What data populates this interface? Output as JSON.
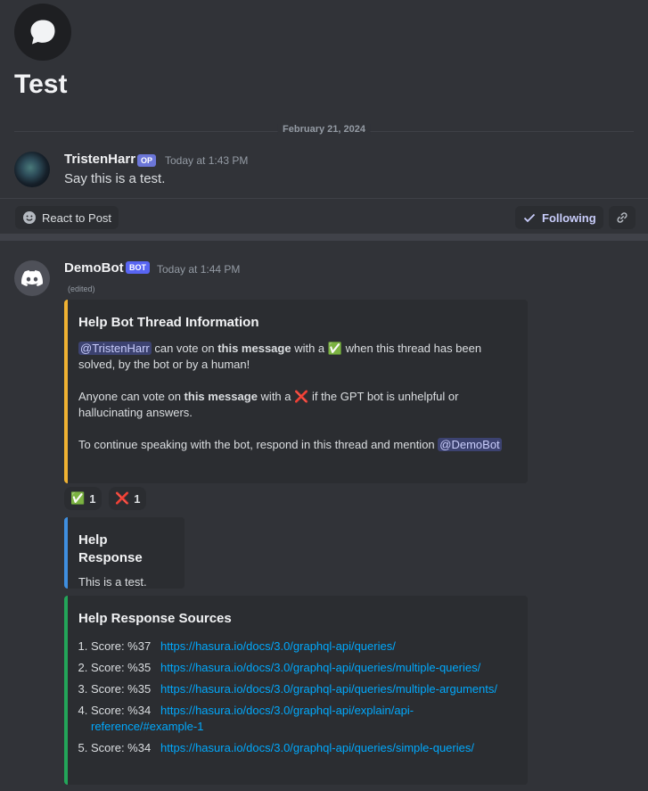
{
  "post": {
    "title": "Test",
    "date_divider": "February 21, 2024"
  },
  "op_message": {
    "author": "TristenHarr",
    "tag": "OP",
    "time": "Today at 1:43 PM",
    "text": "Say this is a test."
  },
  "actions": {
    "react_label": "React to Post",
    "following_label": "Following"
  },
  "bot_message": {
    "author": "DemoBot",
    "tag": "BOT",
    "time": "Today at 1:44 PM",
    "edited": "(edited)"
  },
  "embed_info": {
    "title": "Help Bot Thread Information",
    "p1_mention": "@TristenHarr",
    "p1_a": "can vote on",
    "p1_bold": "this message",
    "p1_b": "with a",
    "p1_c": "when this thread has been solved, by the bot or by a human!",
    "p2_a": "Anyone can vote on",
    "p2_bold": "this message",
    "p2_b": "with a",
    "p2_c": "if the GPT bot is unhelpful or hallucinating answers.",
    "p3_a": "To continue speaking with the bot, respond in this thread and mention",
    "p3_mention": "@DemoBot"
  },
  "reactions": [
    {
      "emoji": "✅",
      "count": "1"
    },
    {
      "emoji": "❌",
      "count": "1"
    }
  ],
  "embed_response": {
    "title": "Help Response",
    "text": "This is a test."
  },
  "embed_sources": {
    "title": "Help Response Sources",
    "items": [
      {
        "score": "Score: %37",
        "url": "https://hasura.io/docs/3.0/graphql-api/queries/"
      },
      {
        "score": "Score: %35",
        "url": "https://hasura.io/docs/3.0/graphql-api/queries/multiple-queries/"
      },
      {
        "score": "Score: %35",
        "url": "https://hasura.io/docs/3.0/graphql-api/queries/multiple-arguments/"
      },
      {
        "score": "Score: %34",
        "url": "https://hasura.io/docs/3.0/graphql-api/explain/api-reference/#example-1"
      },
      {
        "score": "Score: %34",
        "url": "https://hasura.io/docs/3.0/graphql-api/queries/simple-queries/"
      }
    ]
  },
  "colors": {
    "background": "#313338",
    "embed_info_accent": "#f0b232",
    "embed_response_accent": "#3f8fe0",
    "embed_sources_accent": "#23a559",
    "link": "#00a8fc",
    "blurple": "#5865f2"
  },
  "icons": [
    "chat-bubble-icon",
    "smile-icon",
    "check-icon",
    "link-icon",
    "discord-logo-icon"
  ]
}
